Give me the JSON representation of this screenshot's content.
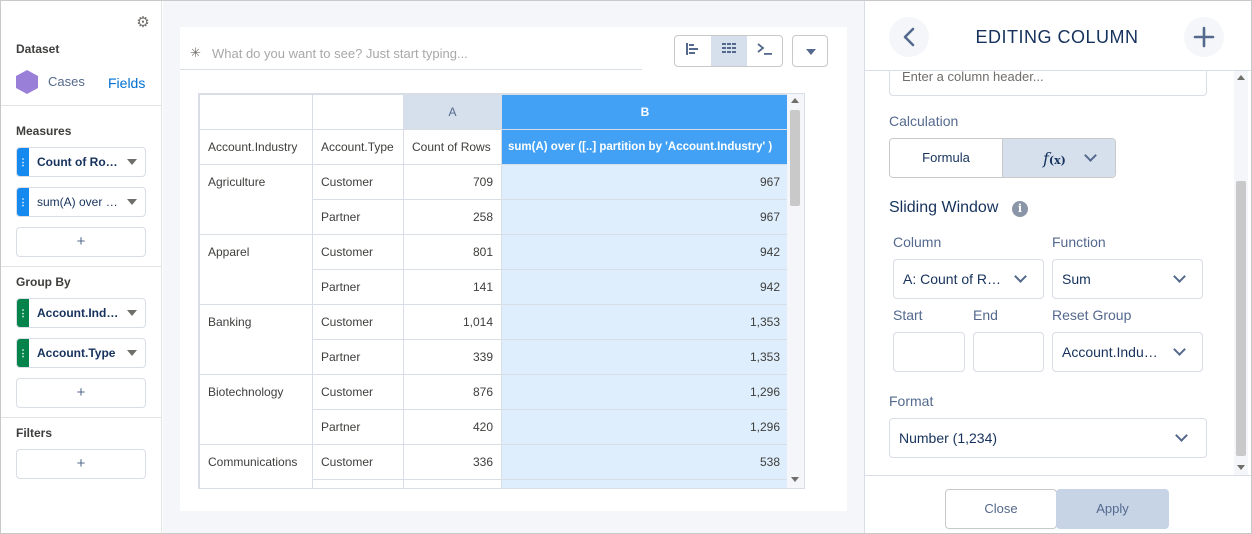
{
  "left_panel": {
    "dataset_title": "Dataset",
    "dataset_name": "Cases",
    "fields_link": "Fields",
    "measures_title": "Measures",
    "measures": [
      "Count of Rows",
      "sum(A) over ([..] partition by 'Account.Industry')"
    ],
    "groupby_title": "Group By",
    "groups": [
      "Account.Industry",
      "Account.Type"
    ],
    "filters_title": "Filters",
    "add_label": "+"
  },
  "query": {
    "placeholder": "What do you want to see? Just start typing..."
  },
  "table": {
    "col_letters": [
      "A",
      "B"
    ],
    "headers": [
      "Account.Industry",
      "Account.Type",
      "Count of Rows",
      "sum(A) over ([..] partition by 'Account.Industry' )"
    ],
    "rows": [
      {
        "industry": "Agriculture",
        "type": "Customer",
        "a": "709",
        "b": "967"
      },
      {
        "industry": "",
        "type": "Partner",
        "a": "258",
        "b": "967"
      },
      {
        "industry": "Apparel",
        "type": "Customer",
        "a": "801",
        "b": "942"
      },
      {
        "industry": "",
        "type": "Partner",
        "a": "141",
        "b": "942"
      },
      {
        "industry": "Banking",
        "type": "Customer",
        "a": "1,014",
        "b": "1,353"
      },
      {
        "industry": "",
        "type": "Partner",
        "a": "339",
        "b": "1,353"
      },
      {
        "industry": "Biotechnology",
        "type": "Customer",
        "a": "876",
        "b": "1,296"
      },
      {
        "industry": "",
        "type": "Partner",
        "a": "420",
        "b": "1,296"
      },
      {
        "industry": "Communications",
        "type": "Customer",
        "a": "336",
        "b": "538"
      },
      {
        "industry": "",
        "type": "",
        "a": "",
        "b": ""
      }
    ]
  },
  "right_panel": {
    "title": "EDITING COLUMN",
    "header_placeholder": "Enter a column header...",
    "calculation_label": "Calculation",
    "formula_btn": "Formula",
    "fx_main": "f",
    "fx_sub": "(x)",
    "sliding_window_title": "Sliding Window",
    "info_glyph": "i",
    "column_label": "Column",
    "column_value": "A: Count of Rows",
    "function_label": "Function",
    "function_value": "Sum",
    "start_label": "Start",
    "end_label": "End",
    "reset_group_label": "Reset Group",
    "reset_group_value": "Account.Industry",
    "format_label": "Format",
    "format_value": "Number (1,234)",
    "close_btn": "Close",
    "apply_btn": "Apply"
  },
  "colors": {
    "accent_blue": "#42a1f5",
    "measure_blue": "#1589ee",
    "group_green": "#04844b",
    "dataset_purple": "#9a7fd8"
  }
}
